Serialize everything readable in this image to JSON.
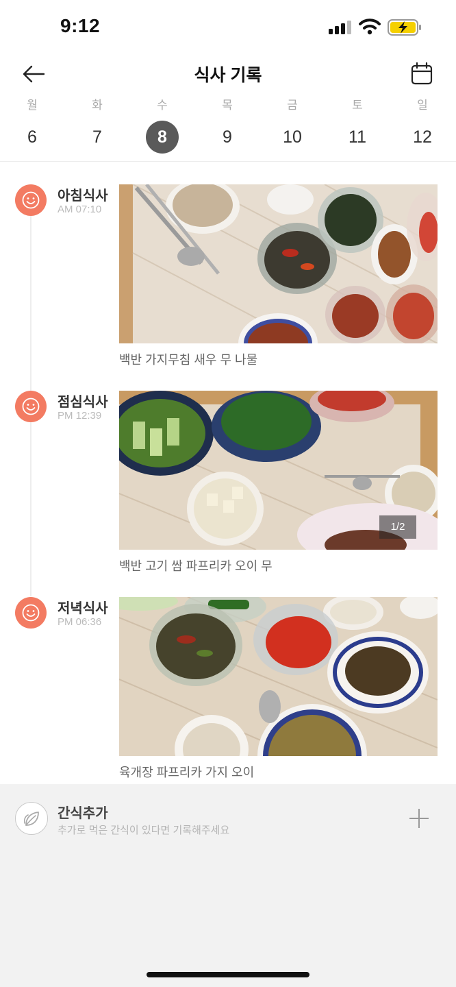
{
  "status_bar": {
    "time": "9:12",
    "battery_color": "#f5d000"
  },
  "header": {
    "title": "식사 기록"
  },
  "week": [
    {
      "day": "월",
      "date": "6"
    },
    {
      "day": "화",
      "date": "7"
    },
    {
      "day": "수",
      "date": "8",
      "selected": true
    },
    {
      "day": "목",
      "date": "9"
    },
    {
      "day": "금",
      "date": "10"
    },
    {
      "day": "토",
      "date": "11"
    },
    {
      "day": "일",
      "date": "12"
    }
  ],
  "meals": [
    {
      "name": "아침식사",
      "time": "AM 07:10",
      "caption": "백반 가지무침 새우 무 나물"
    },
    {
      "name": "점심식사",
      "time": "PM 12:39",
      "caption": "백반 고기 쌈 파프리카 오이 무",
      "photo_counter": "1/2"
    },
    {
      "name": "저녁식사",
      "time": "PM 06:36",
      "caption": "육개장 파프리카 가지 오이"
    }
  ],
  "snack": {
    "title": "간식추가",
    "subtitle": "추가로 먹은 간식이 있다면 기록해주세요"
  },
  "colors": {
    "accent": "#f37b62",
    "selected_day": "#5a5a5a"
  }
}
